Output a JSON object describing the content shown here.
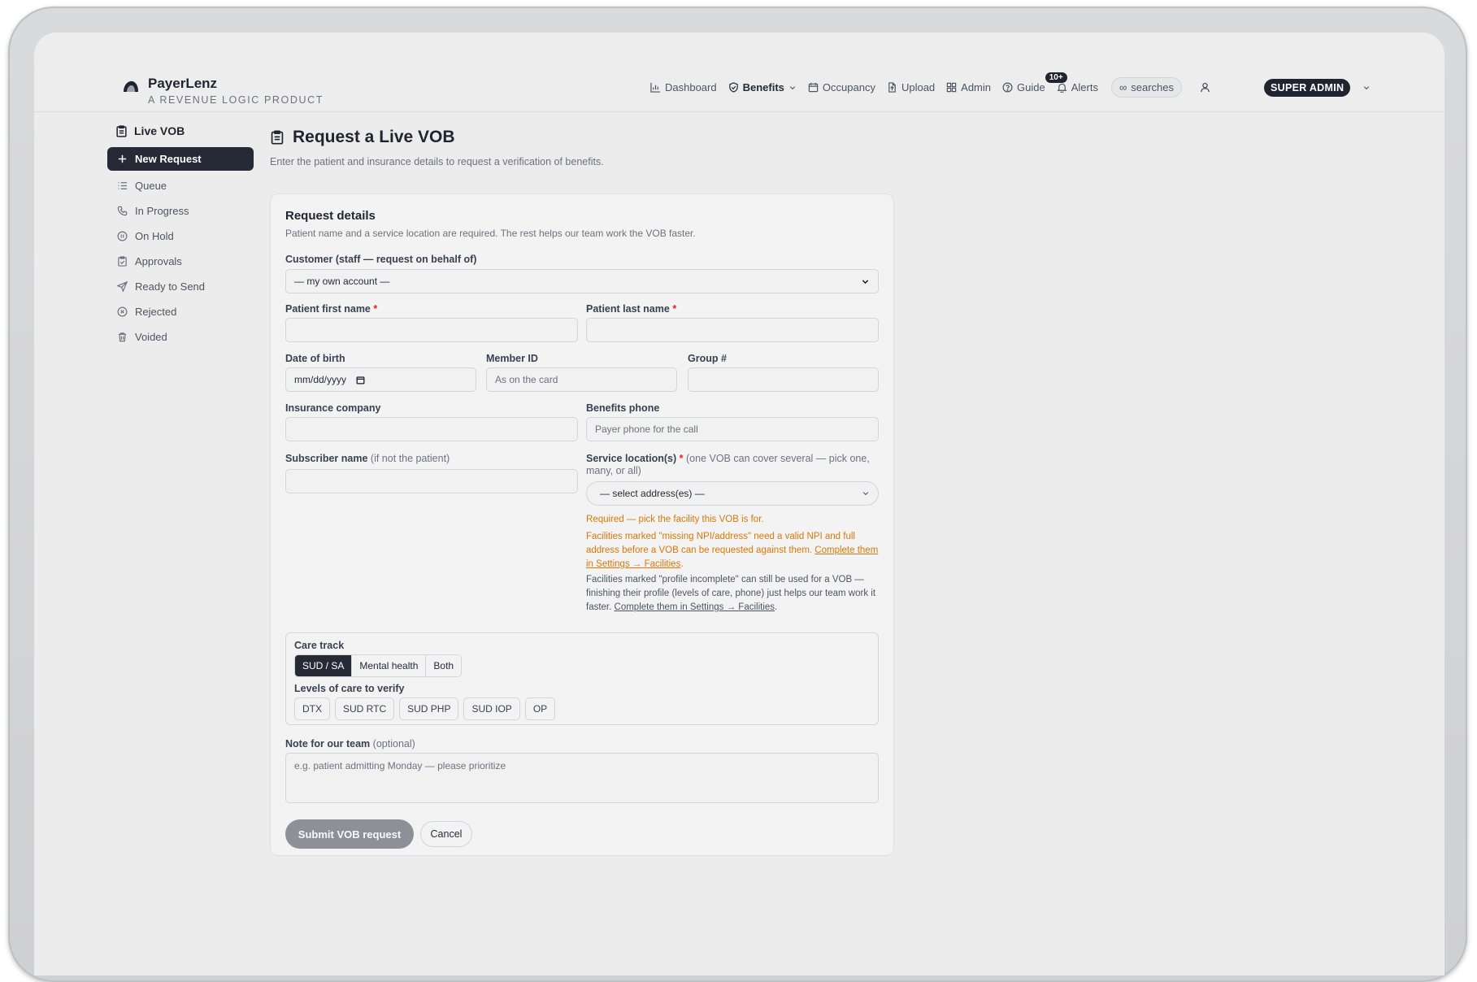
{
  "app": {
    "name": "PayerLenz",
    "tagline": "A REVENUE LOGIC PRODUCT"
  },
  "nav": {
    "items": [
      {
        "label": "Dashboard",
        "icon": "chart-icon"
      },
      {
        "label": "Benefits",
        "icon": "shield-icon",
        "active": true,
        "dropdown": true
      },
      {
        "label": "Occupancy",
        "icon": "calendar-icon"
      },
      {
        "label": "Upload",
        "icon": "file-icon"
      },
      {
        "label": "Admin",
        "icon": "grid-icon"
      },
      {
        "label": "Guide",
        "icon": "help-icon"
      },
      {
        "label": "Alerts",
        "icon": "bell-icon"
      }
    ],
    "alerts_badge": "10+",
    "searches_label": "searches",
    "role_label": "SUPER ADMIN"
  },
  "sidebar": {
    "title": "Live VOB",
    "items": [
      {
        "label": "New Request",
        "icon": "plus-icon",
        "active": true
      },
      {
        "label": "Queue",
        "icon": "list-icon"
      },
      {
        "label": "In Progress",
        "icon": "phone-icon"
      },
      {
        "label": "On Hold",
        "icon": "pause-icon"
      },
      {
        "label": "Approvals",
        "icon": "clipboard-icon"
      },
      {
        "label": "Ready to Send",
        "icon": "send-icon"
      },
      {
        "label": "Rejected",
        "icon": "x-circle-icon"
      },
      {
        "label": "Voided",
        "icon": "trash-icon"
      }
    ]
  },
  "page": {
    "title": "Request a Live VOB",
    "description": "Enter the patient and insurance details to request a verification of benefits."
  },
  "form": {
    "section_title": "Request details",
    "section_desc": "Patient name and a service location are required. The rest helps our team work the VOB faster.",
    "customer_label": "Customer (staff — request on behalf of)",
    "customer_value": "— my own account —",
    "first_name_label": "Patient first name",
    "last_name_label": "Patient last name",
    "required_mark": "*",
    "dob_label": "Date of birth",
    "dob_placeholder": "mm/dd/yyyy",
    "member_id_label": "Member ID",
    "member_id_placeholder": "As on the card",
    "group_label": "Group #",
    "insurance_label": "Insurance company",
    "benefits_phone_label": "Benefits phone",
    "benefits_phone_placeholder": "Payer phone for the call",
    "subscriber_label": "Subscriber name",
    "subscriber_hint": "(if not the patient)",
    "service_label": "Service location(s)",
    "service_hint": "(one VOB can cover several — pick one, many, or all)",
    "service_value": "— select address(es) —",
    "warn_required": "Required — pick the facility this VOB is for.",
    "warn_missing": "Facilities marked \"missing NPI/address\" need a valid NPI and full address before a VOB can be requested against them.",
    "warn_missing_link": "Complete them in Settings → Facilities",
    "info_incomplete": "Facilities marked \"profile incomplete\" can still be used for a VOB — finishing their profile (levels of care, phone) just helps our team work it faster.",
    "info_incomplete_link": "Complete them in Settings → Facilities",
    "care_track_label": "Care track",
    "care_tracks": [
      "SUD / SA",
      "Mental health",
      "Both"
    ],
    "levels_label": "Levels of care to verify",
    "levels": [
      "DTX",
      "SUD RTC",
      "SUD PHP",
      "SUD IOP",
      "OP"
    ],
    "note_label": "Note for our team",
    "note_hint": "(optional)",
    "note_placeholder": "e.g. patient admitting Monday — please prioritize",
    "submit_label": "Submit VOB request",
    "cancel_label": "Cancel"
  }
}
